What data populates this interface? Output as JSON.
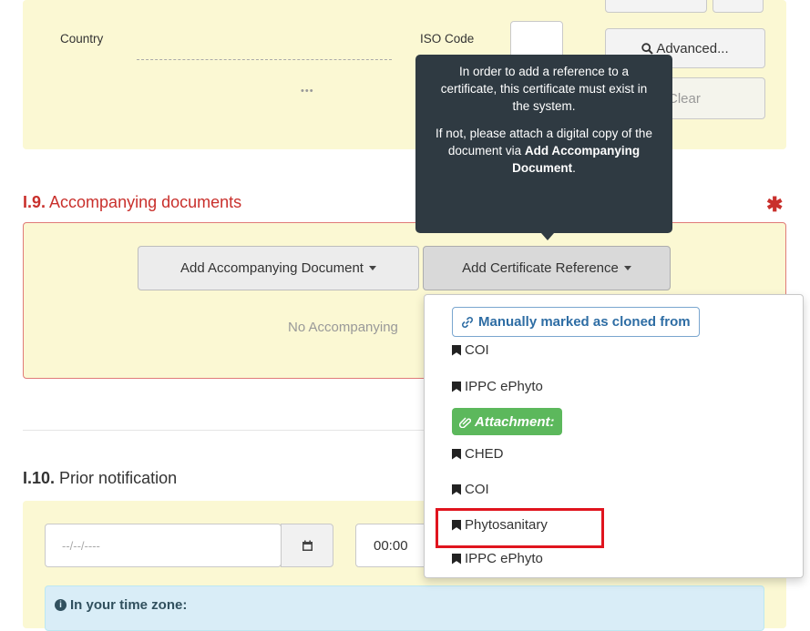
{
  "origin": {
    "country_label": "Country",
    "iso_label": "ISO Code",
    "ellipsis": "•••",
    "advanced_label": "Advanced...",
    "clear_label": "Clear"
  },
  "tooltip": {
    "para1": "In order to add a reference to a certificate, this certificate must exist in the system.",
    "para2_prefix": "If not, please attach a digital copy of the document via ",
    "para2_bold": "Add Accompanying Document",
    "para2_suffix": "."
  },
  "section_i9": {
    "number": "I.9.",
    "title": "Accompanying documents",
    "required_mark": "✱",
    "add_doc_label": "Add Accompanying Document",
    "add_cert_label": "Add Certificate Reference",
    "empty_text": "No Accompanying"
  },
  "dropdown": {
    "manual_header": "Manually marked as cloned from",
    "manual_items": [
      "COI",
      "IPPC ePhyto"
    ],
    "attachment_header": "Attachment:",
    "attachment_items": [
      "CHED",
      "COI",
      "Phytosanitary",
      "IPPC ePhyto"
    ],
    "highlighted_item": "Phytosanitary"
  },
  "section_i10": {
    "number": "I.10.",
    "title": "Prior notification",
    "date_placeholder": "--/--/----",
    "time_value": "00:00",
    "timezone_label": "In your time zone:"
  },
  "colors": {
    "accent_red": "#c9302c",
    "highlight_box": "#e0141e",
    "panel_yellow": "#fbf8d3",
    "tooltip_bg": "#2f3a42",
    "attachment_green": "#5cb85c",
    "link_blue": "#2e6da4"
  }
}
